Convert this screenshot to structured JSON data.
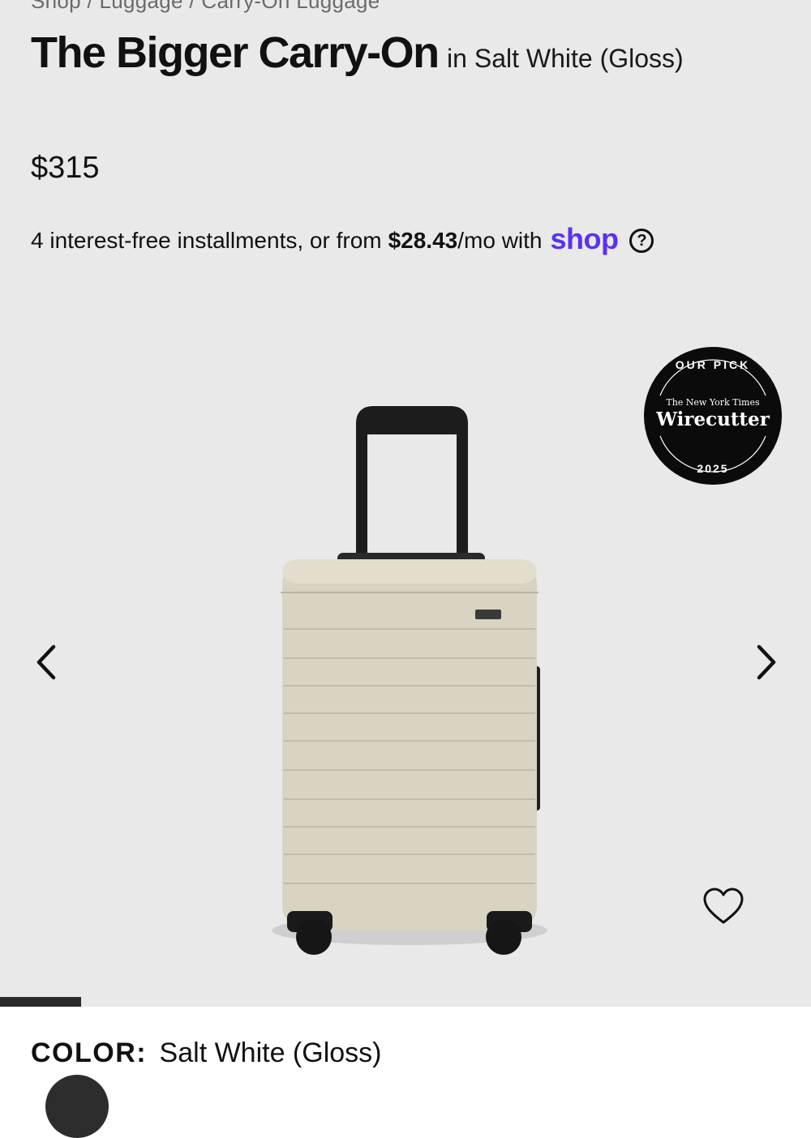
{
  "breadcrumb": "Shop / Luggage / Carry-On Luggage",
  "product": {
    "title": "The Bigger Carry-On",
    "variant": "in Salt White (Gloss)",
    "price": "$315"
  },
  "financing": {
    "text_before": "4 interest-free installments, or from",
    "amount": "$28.43",
    "text_after": "/mo with",
    "provider": "shop",
    "help_icon": "question-circle-icon"
  },
  "badge": {
    "top": "OUR PICK",
    "publisher": "The New York Times",
    "name": "Wirecutter",
    "year": "2025"
  },
  "gallery": {
    "prev_icon": "chevron-left-icon",
    "next_icon": "chevron-right-icon",
    "favorite_icon": "heart-icon",
    "current_image": 1,
    "total_images": 10,
    "progress_fraction": 0.1
  },
  "color": {
    "label": "COLOR:",
    "value": "Salt White (Gloss)"
  },
  "colors": {
    "brand_shop": "#5a31f4",
    "background": "#e9e9ea",
    "suitcase": "#d8d3c2"
  }
}
